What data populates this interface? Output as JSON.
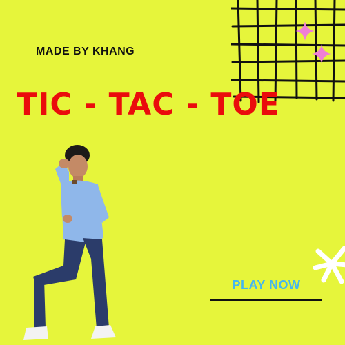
{
  "credit": "MADE BY KHANG",
  "title": "TIC - TAC - TOE",
  "play_button": {
    "label": "PLAY NOW"
  },
  "colors": {
    "background": "#e6f53b",
    "title": "#ea0c0c",
    "play_label": "#45b6ef",
    "sparkle": "#f07ed6",
    "grid_lines": "#111111",
    "starburst": "#ffffff"
  },
  "decorations": {
    "grid": "hand-drawn-grid",
    "sparkles": "four-point-star-icon",
    "starburst": "starburst-icon",
    "figure": "standing-person-photo"
  }
}
